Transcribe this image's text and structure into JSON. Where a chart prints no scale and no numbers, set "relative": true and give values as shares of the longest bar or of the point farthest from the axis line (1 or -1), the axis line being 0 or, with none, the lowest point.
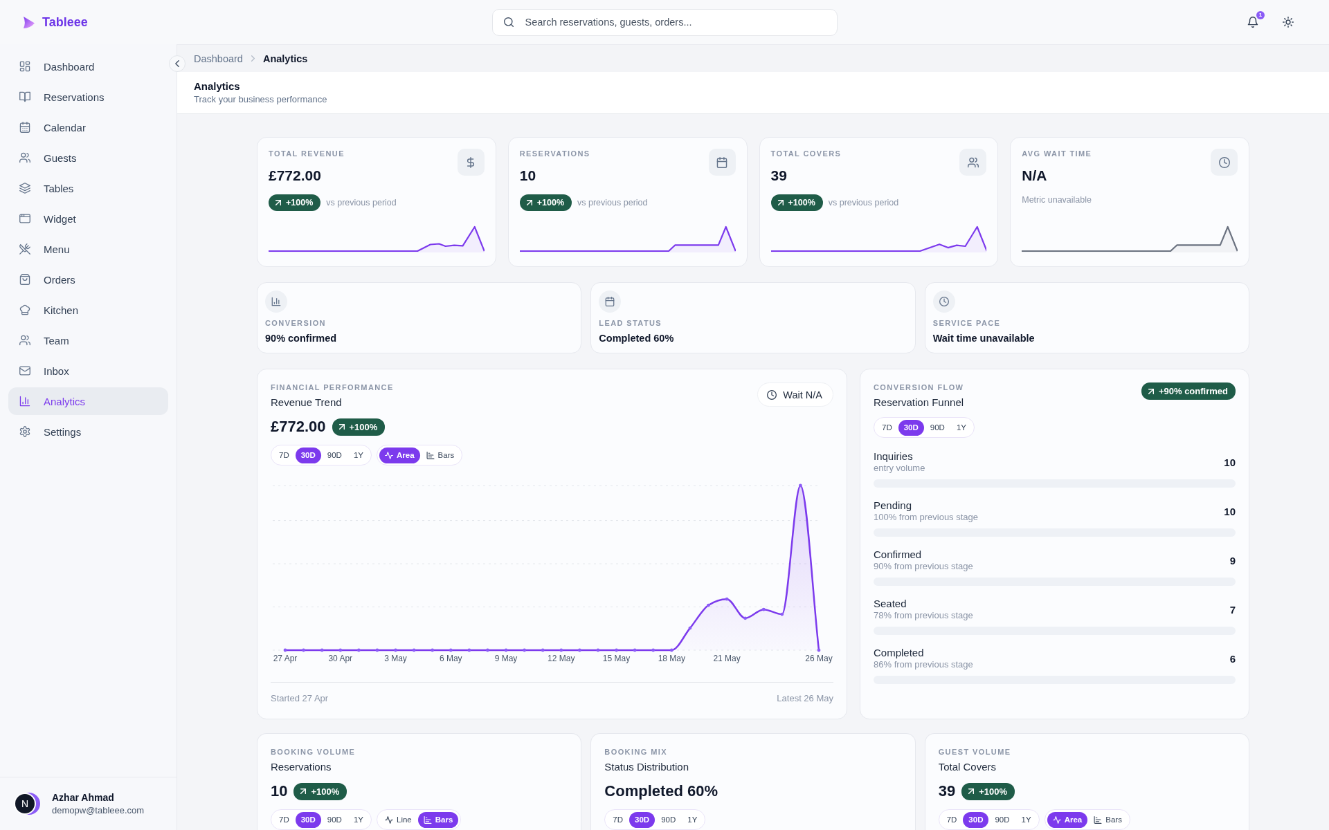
{
  "brand": {
    "name": "Tableee"
  },
  "topbar": {
    "search": {
      "placeholder": "Search reservations, guests, orders..."
    },
    "notification_count": "1"
  },
  "sidebar": {
    "items": [
      {
        "label": "Dashboard",
        "selected": false
      },
      {
        "label": "Reservations",
        "selected": false
      },
      {
        "label": "Calendar",
        "selected": false
      },
      {
        "label": "Guests",
        "selected": false
      },
      {
        "label": "Tables",
        "selected": false
      },
      {
        "label": "Widget",
        "selected": false
      },
      {
        "label": "Menu",
        "selected": false
      },
      {
        "label": "Orders",
        "selected": false
      },
      {
        "label": "Kitchen",
        "selected": false
      },
      {
        "label": "Team",
        "selected": false
      },
      {
        "label": "Inbox",
        "selected": false
      },
      {
        "label": "Analytics",
        "selected": true
      },
      {
        "label": "Settings",
        "selected": false
      }
    ],
    "user": {
      "initial": "N",
      "name": "Azhar Ahmad",
      "email": "demopw@tableee.com"
    }
  },
  "breadcrumb": [
    {
      "label": "Dashboard",
      "selected": false
    },
    {
      "label": "Analytics",
      "selected": true
    }
  ],
  "page_header": {
    "title": "Analytics",
    "subtitle": "Track your business performance"
  },
  "kpi_cards": [
    {
      "kind": "trend",
      "label": "TOTAL REVENUE",
      "value": "£772.00",
      "change": "+100%",
      "comparison": "vs previous period"
    },
    {
      "kind": "trend",
      "label": "RESERVATIONS",
      "value": "10",
      "change": "+100%",
      "comparison": "vs previous period"
    },
    {
      "kind": "trend",
      "label": "TOTAL COVERS",
      "value": "39",
      "change": "+100%",
      "comparison": "vs previous period"
    },
    {
      "kind": "unavailable",
      "label": "AVG WAIT TIME",
      "value": "N/A",
      "note": "Metric unavailable"
    }
  ],
  "insights": [
    {
      "label": "CONVERSION",
      "value": "90% confirmed"
    },
    {
      "label": "LEAD STATUS",
      "value": "Completed 60%"
    },
    {
      "label": "SERVICE PACE",
      "value": "Wait time unavailable"
    }
  ],
  "revenue_trend": {
    "section": "FINANCIAL PERFORMANCE",
    "title": "Revenue Trend",
    "value": "£772.00",
    "change": "+100%",
    "wait": "Wait N/A",
    "ranges": [
      {
        "label": "7D",
        "selected": false
      },
      {
        "label": "30D",
        "selected": true
      },
      {
        "label": "90D",
        "selected": false
      },
      {
        "label": "1Y",
        "selected": false
      }
    ],
    "views": [
      {
        "label": "Area",
        "selected": true
      },
      {
        "label": "Bars",
        "selected": false
      }
    ],
    "chart_data": {
      "type": "area",
      "categories": [
        "27 Apr",
        null,
        null,
        "30 Apr",
        null,
        null,
        "3 May",
        null,
        null,
        "6 May",
        null,
        null,
        "9 May",
        null,
        null,
        "12 May",
        null,
        null,
        "15 May",
        null,
        null,
        "18 May",
        null,
        null,
        "21 May",
        null,
        null,
        null,
        null,
        "26 May"
      ],
      "values": [
        0,
        0,
        0,
        0,
        0,
        0,
        0,
        0,
        0,
        0,
        0,
        0,
        0,
        0,
        0,
        0,
        0,
        0,
        0,
        0,
        0,
        0,
        0.134,
        0.273,
        0.31,
        0.194,
        0.247,
        0.218,
        1,
        0
      ],
      "relative": true
    },
    "footer_start": "Started 27 Apr",
    "footer_end": "Latest 26 May"
  },
  "funnel": {
    "section": "CONVERSION FLOW",
    "title": "Reservation Funnel",
    "badge": "+90% confirmed",
    "ranges": [
      {
        "label": "7D",
        "selected": false
      },
      {
        "label": "30D",
        "selected": true
      },
      {
        "label": "90D",
        "selected": false
      },
      {
        "label": "1Y",
        "selected": false
      }
    ],
    "stages": [
      {
        "name": "Inquiries",
        "detail": "entry volume",
        "count": "10"
      },
      {
        "name": "Pending",
        "detail": "100% from previous stage",
        "count": "10"
      },
      {
        "name": "Confirmed",
        "detail": "90% from previous stage",
        "count": "9"
      },
      {
        "name": "Seated",
        "detail": "78% from previous stage",
        "count": "7"
      },
      {
        "name": "Completed",
        "detail": "86% from previous stage",
        "count": "6"
      }
    ]
  },
  "bottom_cards": [
    {
      "section": "BOOKING VOLUME",
      "title": "Reservations",
      "value": "10",
      "change": "+100%",
      "ranges": [
        {
          "label": "7D",
          "selected": false
        },
        {
          "label": "30D",
          "selected": true
        },
        {
          "label": "90D",
          "selected": false
        },
        {
          "label": "1Y",
          "selected": false
        }
      ],
      "views": [
        {
          "label": "Line",
          "selected": false
        },
        {
          "label": "Bars",
          "selected": true
        }
      ]
    },
    {
      "section": "BOOKING MIX",
      "title": "Status Distribution",
      "value": "Completed 60%",
      "ranges": [
        {
          "label": "7D",
          "selected": false
        },
        {
          "label": "30D",
          "selected": true
        },
        {
          "label": "90D",
          "selected": false
        },
        {
          "label": "1Y",
          "selected": false
        }
      ]
    },
    {
      "section": "GUEST VOLUME",
      "title": "Total Covers",
      "value": "39",
      "change": "+100%",
      "ranges": [
        {
          "label": "7D",
          "selected": false
        },
        {
          "label": "30D",
          "selected": true
        },
        {
          "label": "90D",
          "selected": false
        },
        {
          "label": "1Y",
          "selected": false
        }
      ],
      "views": [
        {
          "label": "Area",
          "selected": true
        },
        {
          "label": "Bars",
          "selected": false
        }
      ]
    }
  ]
}
